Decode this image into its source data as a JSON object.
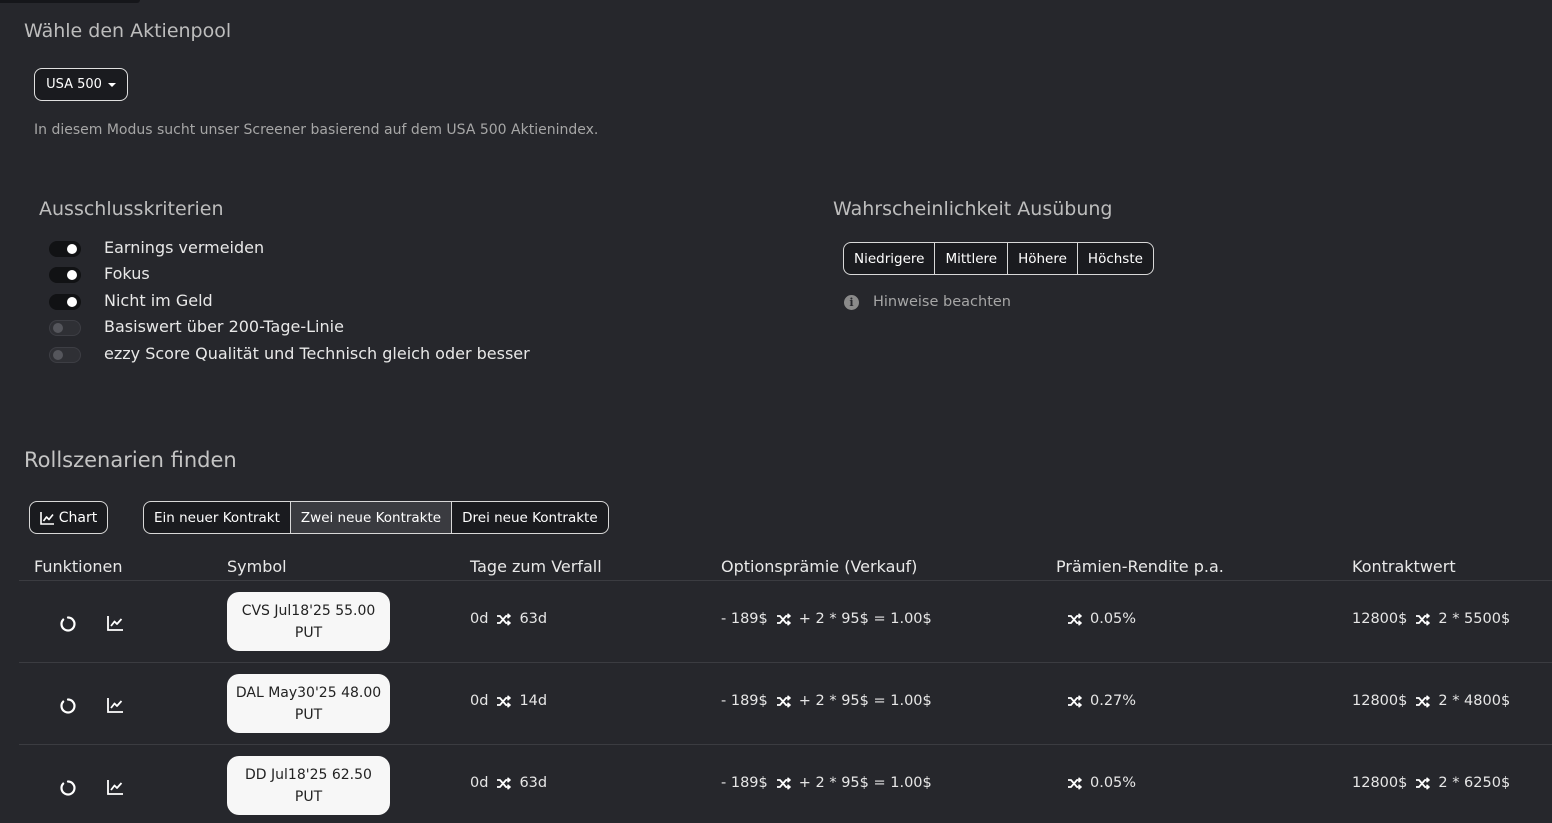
{
  "pool": {
    "title": "Wähle den Aktienpool",
    "selected": "USA 500",
    "description": "In diesem Modus sucht unser Screener basierend auf dem USA 500 Aktienindex."
  },
  "exclusion": {
    "title": "Ausschlusskriterien",
    "items": [
      {
        "label": "Earnings vermeiden",
        "on": true
      },
      {
        "label": "Fokus",
        "on": true
      },
      {
        "label": "Nicht im Geld",
        "on": true
      },
      {
        "label": "Basiswert über 200-Tage-Linie",
        "on": false
      },
      {
        "label": "ezzy Score Qualität und Technisch gleich oder besser",
        "on": false
      }
    ]
  },
  "probability": {
    "title": "Wahrscheinlichkeit Ausübung",
    "options": [
      "Niedrigere",
      "Mittlere",
      "Höhere",
      "Höchste"
    ],
    "hint": "Hinweise beachten"
  },
  "roll": {
    "title": "Rollszenarien finden",
    "chart_label": "Chart",
    "modes": [
      "Ein neuer Kontrakt",
      "Zwei neue Kontrakte",
      "Drei neue Kontrakte"
    ],
    "active_mode": "Zwei neue Kontrakte"
  },
  "table": {
    "headers": {
      "functions": "Funktionen",
      "symbol": "Symbol",
      "days": "Tage zum Verfall",
      "premium": "Optionsprämie (Verkauf)",
      "yield": "Prämien-Rendite p.a.",
      "value": "Kontraktwert"
    },
    "rows": [
      {
        "symbol": "CVS Jul18'25 55.00",
        "type": "PUT",
        "days_from": "0d",
        "days_to": "63d",
        "premium_old": "- 189$",
        "premium_new": "+ 2 * 95$ = 1.00$",
        "yield": "0.05%",
        "value_old": "12800$",
        "value_new": "2 * 5500$"
      },
      {
        "symbol": "DAL May30'25 48.00",
        "type": "PUT",
        "days_from": "0d",
        "days_to": "14d",
        "premium_old": "- 189$",
        "premium_new": "+ 2 * 95$ = 1.00$",
        "yield": "0.27%",
        "value_old": "12800$",
        "value_new": "2 * 4800$"
      },
      {
        "symbol": "DD Jul18'25 62.50",
        "type": "PUT",
        "days_from": "0d",
        "days_to": "63d",
        "premium_old": "- 189$",
        "premium_new": "+ 2 * 95$ = 1.00$",
        "yield": "0.05%",
        "value_old": "12800$",
        "value_new": "2 * 6250$"
      }
    ]
  }
}
